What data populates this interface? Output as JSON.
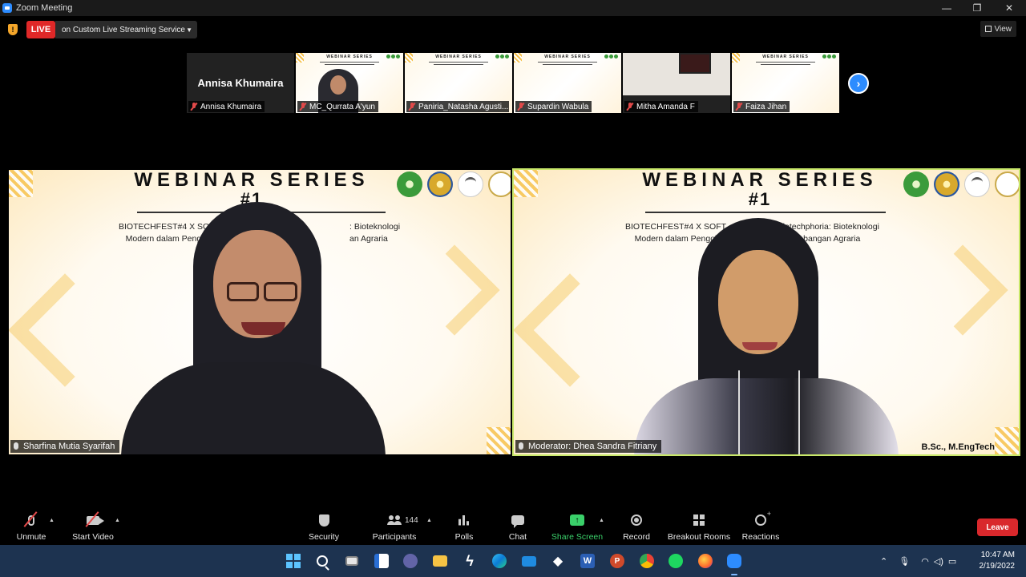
{
  "window": {
    "title": "Zoom Meeting",
    "controls": [
      "—",
      "❐",
      "✕"
    ]
  },
  "topbar": {
    "live_label": "LIVE",
    "live_service": "on Custom Live Streaming Service",
    "view_label": "View"
  },
  "thumbnails": [
    {
      "name": "Annisa Khumaira",
      "big_name": "Annisa Khumaira",
      "type": "name-only"
    },
    {
      "name": "MC_Qurrata A'yun",
      "type": "person"
    },
    {
      "name": "Paniria_Natasha Agusti...",
      "type": "slide"
    },
    {
      "name": "Supardin Wabula",
      "type": "slide"
    },
    {
      "name": "Mitha Amanda F",
      "type": "room"
    },
    {
      "name": "Faiza Jihan",
      "type": "slide"
    }
  ],
  "slide": {
    "title": "WEBINAR SERIES",
    "number": "#1",
    "subtitle_left_1": "BIOTECHFEST#4 X SOFT LAUN",
    "subtitle_left_1b": ": Bioteknologi",
    "subtitle_left_2": "Modern dalam Pengolahan Pr",
    "subtitle_left_2b": "an Agraria",
    "subtitle_right_1": "BIOTECHFEST#4 X SOFT",
    "subtitle_right_1b": "\" Biotechphoria: Bioteknologi",
    "subtitle_right_2": "Modern dalam Pengol",
    "subtitle_right_2b": "Pengembangan Agraria"
  },
  "tiles": [
    {
      "name": "Sharfina Mutia Syarifah"
    },
    {
      "name": "Moderator: Dhea Sandra Fitriany",
      "credit": "B.Sc., M.EngTech"
    }
  ],
  "toolbar": {
    "unmute": "Unmute",
    "start_video": "Start Video",
    "security": "Security",
    "participants": "Participants",
    "participant_count": "144",
    "polls": "Polls",
    "chat": "Chat",
    "share_screen": "Share Screen",
    "record": "Record",
    "breakout_rooms": "Breakout Rooms",
    "reactions": "Reactions",
    "leave": "Leave"
  },
  "taskbar": {
    "time": "10:47 AM",
    "date": "2/19/2022"
  },
  "colors": {
    "live_red": "#e02828",
    "zoom_blue": "#2d8cff",
    "share_green": "#3ad06a",
    "leave_red": "#d9282c",
    "active_speaker_border": "#c9e86a",
    "taskbar_bg": "#1d3350"
  }
}
